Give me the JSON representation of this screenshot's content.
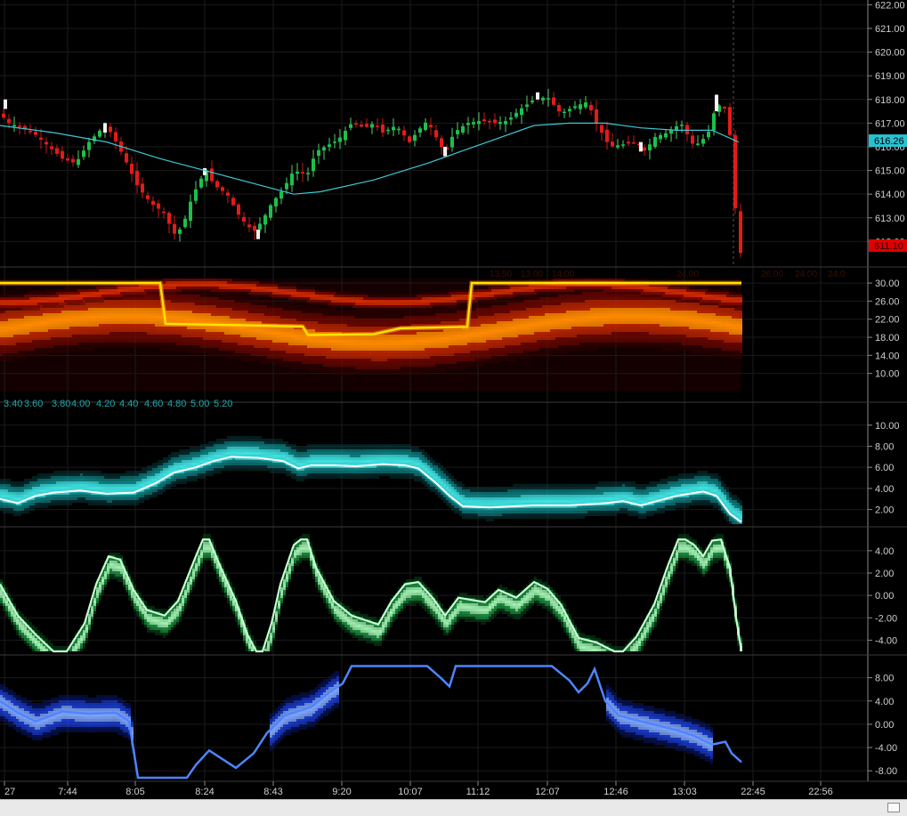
{
  "chart_data": [
    {
      "type": "candlestick",
      "panel": "price",
      "y_ticks": [
        "622.00",
        "621.00",
        "620.00",
        "619.00",
        "618.00",
        "617.00",
        "616.00",
        "615.00",
        "614.00",
        "613.00",
        "612.00"
      ],
      "ylim": [
        611,
        622.2
      ],
      "overlay_ma_color": "#3ec7d4",
      "last_price_label": "616.26",
      "last_price_color": "#27c2d2",
      "current_price_label": "611.10",
      "current_price_color": "#e00000",
      "close_path": [
        [
          0,
          617.4
        ],
        [
          10,
          617.0
        ],
        [
          25,
          616.8
        ],
        [
          40,
          616.5
        ],
        [
          55,
          616.0
        ],
        [
          70,
          615.5
        ],
        [
          85,
          615.3
        ],
        [
          100,
          616.2
        ],
        [
          115,
          616.8
        ],
        [
          125,
          616.6
        ],
        [
          140,
          615.5
        ],
        [
          155,
          614.3
        ],
        [
          170,
          613.6
        ],
        [
          185,
          613.2
        ],
        [
          195,
          612.3
        ],
        [
          205,
          612.6
        ],
        [
          215,
          613.8
        ],
        [
          225,
          614.6
        ],
        [
          232,
          615.0
        ],
        [
          240,
          614.4
        ],
        [
          255,
          614.0
        ],
        [
          270,
          613.0
        ],
        [
          285,
          612.4
        ],
        [
          295,
          612.9
        ],
        [
          305,
          613.6
        ],
        [
          318,
          614.2
        ],
        [
          330,
          615.0
        ],
        [
          345,
          614.8
        ],
        [
          355,
          615.8
        ],
        [
          365,
          616.0
        ],
        [
          380,
          616.3
        ],
        [
          395,
          617.0
        ],
        [
          410,
          616.8
        ],
        [
          420,
          617.0
        ],
        [
          430,
          616.6
        ],
        [
          445,
          616.9
        ],
        [
          460,
          616.2
        ],
        [
          470,
          616.7
        ],
        [
          480,
          617.1
        ],
        [
          490,
          616.4
        ],
        [
          500,
          615.7
        ],
        [
          510,
          616.6
        ],
        [
          525,
          617.0
        ],
        [
          540,
          617.1
        ],
        [
          555,
          617.0
        ],
        [
          570,
          617.1
        ],
        [
          585,
          617.6
        ],
        [
          600,
          618.0
        ],
        [
          615,
          618.1
        ],
        [
          630,
          617.4
        ],
        [
          645,
          617.7
        ],
        [
          660,
          617.9
        ],
        [
          670,
          617.0
        ],
        [
          685,
          616.0
        ],
        [
          700,
          616.1
        ],
        [
          715,
          616.2
        ],
        [
          725,
          615.8
        ],
        [
          735,
          616.4
        ],
        [
          750,
          616.6
        ],
        [
          765,
          617.0
        ],
        [
          780,
          616.0
        ],
        [
          795,
          616.5
        ],
        [
          805,
          617.8
        ],
        [
          815,
          617.6
        ],
        [
          820,
          616.5
        ],
        [
          826,
          613.4
        ],
        [
          833,
          611.2
        ]
      ],
      "ma_path": [
        [
          0,
          616.9
        ],
        [
          60,
          616.6
        ],
        [
          120,
          616.2
        ],
        [
          180,
          615.5
        ],
        [
          240,
          614.9
        ],
        [
          300,
          614.3
        ],
        [
          330,
          614.0
        ],
        [
          360,
          614.1
        ],
        [
          420,
          614.6
        ],
        [
          480,
          615.3
        ],
        [
          540,
          616.1
        ],
        [
          600,
          616.9
        ],
        [
          640,
          617.0
        ],
        [
          680,
          617.0
        ],
        [
          720,
          616.8
        ],
        [
          760,
          616.7
        ],
        [
          800,
          616.7
        ],
        [
          830,
          616.2
        ]
      ]
    },
    {
      "type": "heatmap",
      "panel": "heatmap-1",
      "y_ticks": [
        "30.00",
        "26.00",
        "22.00",
        "18.00",
        "14.00",
        "10.00"
      ],
      "ylim": [
        6,
        31
      ],
      "colorscale": [
        "#000000",
        "#3a0000",
        "#8a0800",
        "#d22a00",
        "#ff8a00",
        "#ffe600"
      ],
      "ridge_line": [
        [
          0,
          30
        ],
        [
          180,
          30
        ],
        [
          186,
          21
        ],
        [
          340,
          20.4
        ],
        [
          346,
          18.5
        ],
        [
          420,
          18.7
        ],
        [
          450,
          20
        ],
        [
          525,
          20.3
        ],
        [
          530,
          30
        ],
        [
          833,
          30
        ]
      ],
      "faint_labels": [
        "13.50",
        "13.00",
        "14.00",
        "",
        "",
        "24.00",
        "26.00",
        "24.00",
        "24.0"
      ]
    },
    {
      "type": "heatmap",
      "panel": "heatmap-2",
      "x_ticks_top": [
        "3.40",
        "3.60",
        "3.80",
        "4.00",
        "4.20",
        "4.40",
        "4.60",
        "4.80",
        "5.00",
        "5.20"
      ],
      "y_ticks": [
        "10.00",
        "8.00",
        "6.00",
        "4.00",
        "2.00"
      ],
      "ylim": [
        0.7,
        11.5
      ],
      "colorscale": [
        "#000000",
        "#07474a",
        "#11a0a3",
        "#3fe1e1",
        "#ffffff"
      ],
      "line": [
        [
          0,
          3.0
        ],
        [
          20,
          2.6
        ],
        [
          40,
          3.3
        ],
        [
          60,
          3.6
        ],
        [
          90,
          3.8
        ],
        [
          120,
          3.5
        ],
        [
          150,
          3.6
        ],
        [
          175,
          4.5
        ],
        [
          195,
          5.5
        ],
        [
          220,
          6.0
        ],
        [
          240,
          6.6
        ],
        [
          260,
          7.0
        ],
        [
          290,
          6.9
        ],
        [
          318,
          6.6
        ],
        [
          335,
          5.9
        ],
        [
          350,
          6.2
        ],
        [
          375,
          6.2
        ],
        [
          400,
          6.1
        ],
        [
          430,
          6.3
        ],
        [
          455,
          6.2
        ],
        [
          470,
          5.9
        ],
        [
          490,
          4.5
        ],
        [
          505,
          3.3
        ],
        [
          520,
          2.3
        ],
        [
          550,
          2.2
        ],
        [
          600,
          2.4
        ],
        [
          640,
          2.4
        ],
        [
          680,
          2.6
        ],
        [
          700,
          2.8
        ],
        [
          720,
          2.4
        ],
        [
          760,
          3.3
        ],
        [
          790,
          3.7
        ],
        [
          805,
          3.3
        ],
        [
          820,
          1.6
        ],
        [
          833,
          0.8
        ]
      ]
    },
    {
      "type": "heatmap",
      "panel": "oscillator-green",
      "y_ticks": [
        "4.00",
        "2.00",
        "0.00",
        "-2.00",
        "-4.00"
      ],
      "ylim": [
        -5,
        5.5
      ],
      "colorscale": [
        "#000000",
        "#0a5a24",
        "#21b04d",
        "#9ff0b0"
      ],
      "line": [
        [
          0,
          1.0
        ],
        [
          20,
          -1.8
        ],
        [
          40,
          -3.5
        ],
        [
          60,
          -5
        ],
        [
          75,
          -5
        ],
        [
          95,
          -2.5
        ],
        [
          108,
          1.0
        ],
        [
          122,
          3.5
        ],
        [
          135,
          3.2
        ],
        [
          150,
          0.5
        ],
        [
          165,
          -1.3
        ],
        [
          185,
          -1.8
        ],
        [
          200,
          -0.5
        ],
        [
          220,
          3.5
        ],
        [
          228,
          5
        ],
        [
          235,
          5
        ],
        [
          248,
          2.5
        ],
        [
          265,
          -0.5
        ],
        [
          278,
          -3.5
        ],
        [
          288,
          -5
        ],
        [
          295,
          -5
        ],
        [
          305,
          -2.5
        ],
        [
          315,
          1.0
        ],
        [
          330,
          4.5
        ],
        [
          338,
          5
        ],
        [
          345,
          5
        ],
        [
          355,
          2.5
        ],
        [
          375,
          -0.5
        ],
        [
          395,
          -1.8
        ],
        [
          425,
          -2.6
        ],
        [
          440,
          -0.5
        ],
        [
          455,
          1.0
        ],
        [
          470,
          1.2
        ],
        [
          487,
          -0.3
        ],
        [
          500,
          -1.8
        ],
        [
          515,
          -0.2
        ],
        [
          545,
          -0.6
        ],
        [
          560,
          0.5
        ],
        [
          580,
          -0.2
        ],
        [
          600,
          1.2
        ],
        [
          615,
          0.6
        ],
        [
          630,
          -0.8
        ],
        [
          650,
          -3.8
        ],
        [
          670,
          -4.2
        ],
        [
          690,
          -5
        ],
        [
          700,
          -5
        ],
        [
          715,
          -3.7
        ],
        [
          735,
          -0.8
        ],
        [
          750,
          2.6
        ],
        [
          762,
          5
        ],
        [
          770,
          5
        ],
        [
          780,
          4.5
        ],
        [
          790,
          3.5
        ],
        [
          800,
          4.9
        ],
        [
          810,
          5
        ],
        [
          820,
          2.5
        ],
        [
          827,
          -2
        ],
        [
          833,
          -5
        ]
      ]
    },
    {
      "type": "heatmap",
      "panel": "oscillator-blue",
      "y_ticks": [
        "8.00",
        "4.00",
        "0.00",
        "-4.00",
        "-8.00"
      ],
      "ylim": [
        -9.5,
        11
      ],
      "colorscale": [
        "#000000",
        "#0a1c8a",
        "#1f49ff",
        "#7fa6ff"
      ],
      "line": [
        [
          0,
          4.0
        ],
        [
          20,
          2.0
        ],
        [
          40,
          0.5
        ],
        [
          70,
          2.2
        ],
        [
          100,
          1.8
        ],
        [
          130,
          2.0
        ],
        [
          145,
          0.5
        ],
        [
          155,
          -9.2
        ],
        [
          185,
          -9.2
        ],
        [
          210,
          -9.2
        ],
        [
          220,
          -7.0
        ],
        [
          235,
          -4.5
        ],
        [
          250,
          -6.0
        ],
        [
          265,
          -7.5
        ],
        [
          285,
          -5.0
        ],
        [
          300,
          -1.5
        ],
        [
          320,
          1.5
        ],
        [
          350,
          3.0
        ],
        [
          370,
          5.5
        ],
        [
          385,
          7.0
        ],
        [
          395,
          10
        ],
        [
          480,
          10
        ],
        [
          495,
          8.0
        ],
        [
          505,
          6.5
        ],
        [
          512,
          10
        ],
        [
          520,
          10
        ],
        [
          570,
          10
        ],
        [
          620,
          10
        ],
        [
          640,
          7.5
        ],
        [
          650,
          5.5
        ],
        [
          660,
          7.0
        ],
        [
          668,
          9.5
        ],
        [
          680,
          4.0
        ],
        [
          695,
          1.5
        ],
        [
          720,
          0.5
        ],
        [
          760,
          -1.0
        ],
        [
          780,
          -2.0
        ],
        [
          800,
          -3.5
        ],
        [
          815,
          -3.0
        ],
        [
          822,
          -5.0
        ],
        [
          833,
          -6.5
        ]
      ]
    },
    {
      "type": "axis",
      "panel": "time-axis",
      "x_ticks": [
        {
          "label": "27",
          "x": 5
        },
        {
          "label": "7:44",
          "x": 76
        },
        {
          "label": "8:05",
          "x": 152
        },
        {
          "label": "8:24",
          "x": 230
        },
        {
          "label": "8:43",
          "x": 307
        },
        {
          "label": "9:20",
          "x": 384
        },
        {
          "label": "10:07",
          "x": 461
        },
        {
          "label": "11:12",
          "x": 537
        },
        {
          "label": "12:07",
          "x": 615
        },
        {
          "label": "12:46",
          "x": 692
        },
        {
          "label": "13:03",
          "x": 769
        },
        {
          "label": "22:45",
          "x": 846
        },
        {
          "label": "22:56",
          "x": 922
        }
      ]
    }
  ]
}
